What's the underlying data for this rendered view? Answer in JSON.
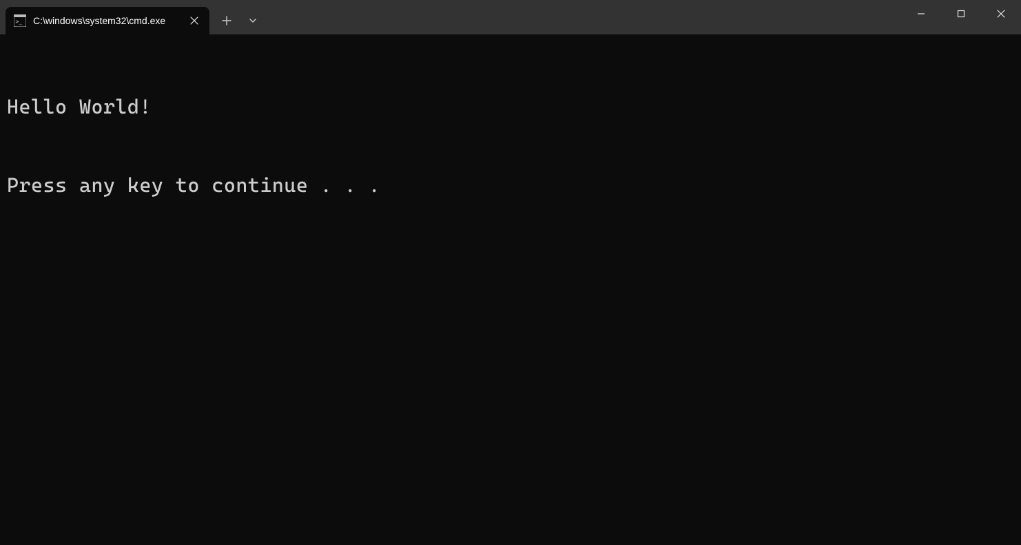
{
  "tab": {
    "icon_name": "cmd-icon",
    "title": "C:\\windows\\system32\\cmd.exe"
  },
  "terminal": {
    "lines": [
      "Hello World!",
      "Press any key to continue . . ."
    ]
  }
}
